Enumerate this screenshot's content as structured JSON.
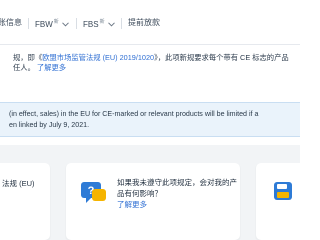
{
  "nav": {
    "items": [
      {
        "label": "账信息",
        "has_dropdown": false
      },
      {
        "label": "FBW",
        "badge": "新",
        "has_dropdown": true
      },
      {
        "label": "FBS",
        "badge": "新",
        "has_dropdown": true
      },
      {
        "label": "提前放款",
        "has_dropdown": false
      }
    ]
  },
  "intro": {
    "line1_prefix": "规，即《",
    "regulation": "欧盟市场监管法规 (EU) 2019/1020",
    "line1_suffix": "》，此项新规要求每个带有 CE 标志的产品",
    "line2_prefix": "任人。",
    "learn_more": "了解更多"
  },
  "banner": {
    "line1": "(in effect, sales) in the EU for CE-marked or relevant products will be limited if a",
    "line2": "en linked by July 9, 2021."
  },
  "cards": {
    "left_title": "法规 (EU)",
    "middle_text": "如果我未遵守此项规定，会对我的产品有何影响？",
    "middle_learn_more": "了解更多"
  },
  "colors": {
    "accent_blue": "#2f6fd3",
    "banner_bg": "#eaf3fb",
    "icon_blue": "#2e7bd6",
    "icon_yellow": "#f5b400"
  }
}
